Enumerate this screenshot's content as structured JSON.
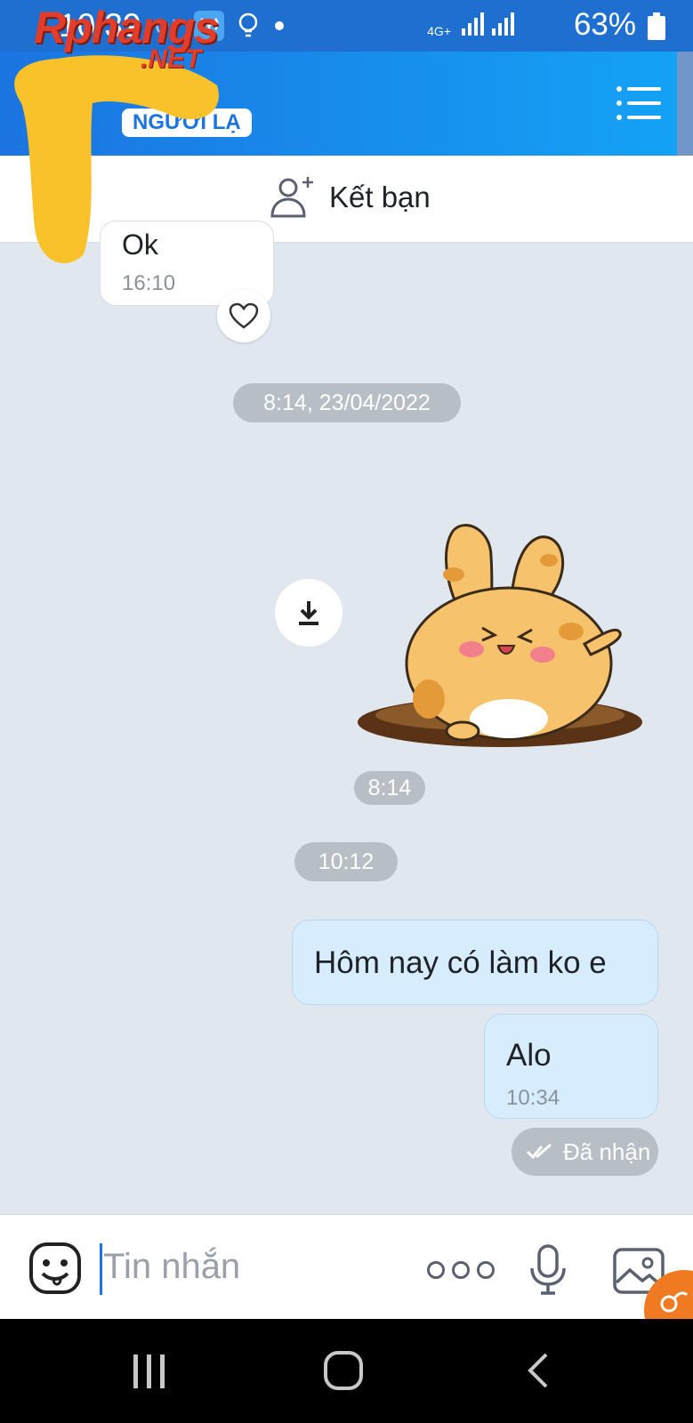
{
  "status_bar": {
    "time": "10:39",
    "battery": "63%",
    "network": "4G+"
  },
  "header": {
    "contact_name": "NGƯỜI LẠ",
    "watermark_line1": "Rphangs",
    "watermark_line2": ".NET",
    "menu_icon": "menu-icon"
  },
  "add_friend": {
    "label": "Kết bạn"
  },
  "messages": {
    "incoming_text": "Ok",
    "incoming_time": "16:10",
    "date_separator": "8:14, 23/04/2022",
    "sticker_time": "8:14",
    "time_separator": "10:12",
    "outgoing_1": "Hôm nay có làm ko e",
    "outgoing_2": "Alo",
    "outgoing_2_time": "10:34",
    "status": "Đã nhận"
  },
  "input": {
    "placeholder": "Tin nhắn"
  },
  "colors": {
    "header_start": "#1b74e0",
    "header_end": "#14a3f6",
    "chat_bg": "#e1e7ef",
    "outgoing_bubble": "#d7edfd",
    "accent_orange": "#f07a22"
  }
}
